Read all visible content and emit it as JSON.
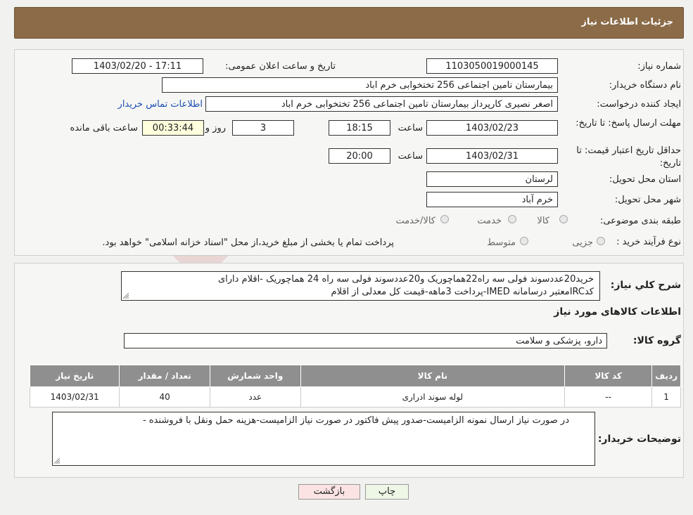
{
  "header": {
    "title": "جزئیات اطلاعات نیاز"
  },
  "watermark": {
    "text": "AriaTender.neT"
  },
  "form": {
    "need_number_label": "شماره نیاز:",
    "need_number": "1103050019000145",
    "announce_label": "تاریخ و ساعت اعلان عمومی:",
    "announce_value": "1403/02/20 - 17:11",
    "buyer_org_label": "نام دستگاه خریدار:",
    "buyer_org": "بیمارستان تامین اجتماعی  256 تختخوابی خرم اباد",
    "creator_label": "ایجاد کننده درخواست:",
    "creator": "اصغر نصیری کارپرداز بیمارستان تامین اجتماعی  256 تختخوابی خرم اباد",
    "contact_link": "اطلاعات تماس خریدار",
    "send_deadline_label": "مهلت ارسال پاسخ: تا تاریخ:",
    "send_deadline_date": "1403/02/23",
    "time_label": "ساعت",
    "send_deadline_time": "18:15",
    "days_value": "3",
    "days_label": "روز و",
    "remaining_value": "00:33:44",
    "remaining_label": "ساعت باقی مانده",
    "price_validity_label": "حداقل تاریخ اعتبار قیمت: تا تاریخ:",
    "price_validity_date": "1403/02/31",
    "price_validity_time": "20:00",
    "province_label": "استان محل تحویل:",
    "province": "لرستان",
    "city_label": "شهر محل تحویل:",
    "city": "خرم آباد",
    "category_label": "طبقه بندی موضوعی:",
    "category_options": [
      "کالا",
      "خدمت",
      "کالا/خدمت"
    ],
    "process_label": "نوع فرآیند خرید :",
    "process_options": [
      "جزیی",
      "متوسط"
    ],
    "process_note": "پرداخت تمام یا بخشی از مبلغ خرید،از محل \"اسناد خزانه اسلامی\" خواهد بود."
  },
  "summary": {
    "label": "شرح کلي نياز:",
    "line1": "خرید20عددسوند فولی سه راه22هماچوریک و20عددسوند فولی سه راه 24 هماچوریک -اقلام دارای",
    "line2": "کدIRCمعتبر درسامانه IMED-پرداخت 3ماهه-قیمت کل معدلی از اقلام",
    "goods_info_title": "اطلاعات کالاهای مورد نیاز",
    "goods_group_label": "گروه کالا:",
    "goods_group": "دارو، پزشکی و سلامت"
  },
  "table": {
    "headers": [
      "ردیف",
      "کد کالا",
      "نام کالا",
      "واحد شمارش",
      "تعداد / مقدار",
      "تاریخ نیاز"
    ],
    "rows": [
      [
        "1",
        "--",
        "لوله سوند ادراری",
        "عدد",
        "40",
        "1403/02/31"
      ]
    ]
  },
  "notes": {
    "label": "توضیحات خریدار:",
    "text": "در صورت نیاز ارسال نمونه الزامیست-صدور پیش فاکتور در صورت نیاز الزامیست-هزینه حمل ونقل با فروشنده -"
  },
  "buttons": {
    "print": "چاپ",
    "back": "بازگشت"
  },
  "colors": {
    "header_bg": "#8b6b48",
    "link": "#1a4fb5",
    "print_btn": "#eef7e6",
    "back_btn": "#fbe3e3"
  }
}
